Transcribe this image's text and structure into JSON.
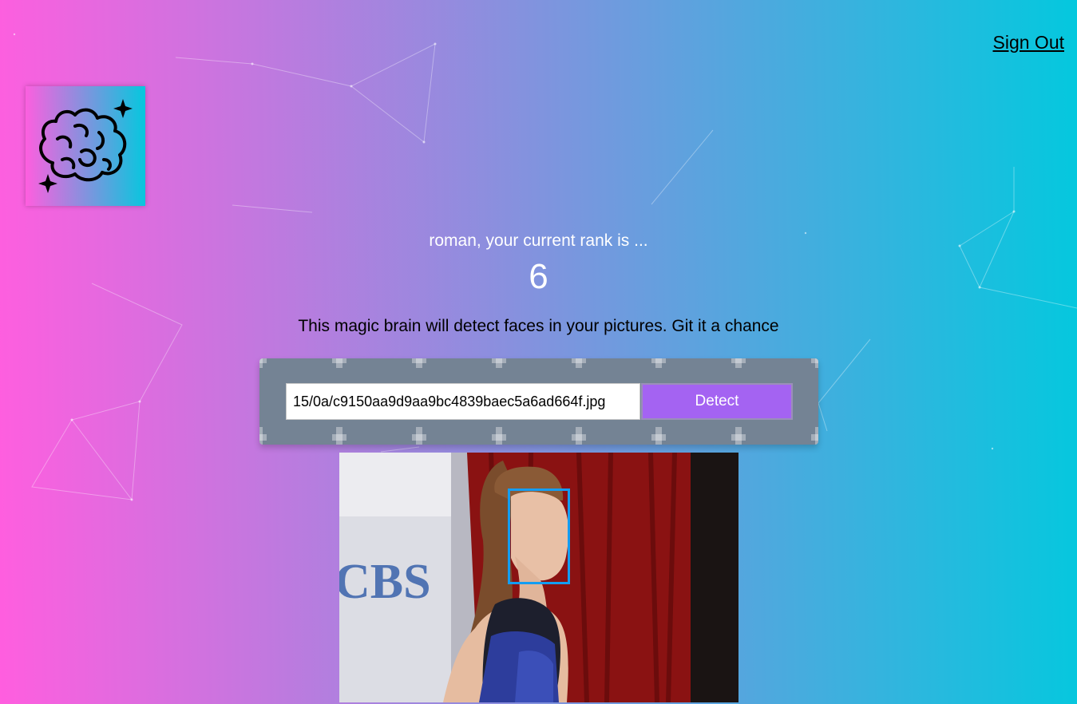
{
  "nav": {
    "signout_label": "Sign Out"
  },
  "logo": {
    "icon": "brain-sparkles-icon"
  },
  "rank": {
    "line": "roman, your current rank is ...",
    "value": "6"
  },
  "description": "This magic brain will detect faces in your pictures. Git it a chance",
  "form": {
    "url_value": "15/0a/c9150aa9d9aa9bc4839baec5a6ad664f.jpg",
    "detect_label": "Detect"
  },
  "photo": {
    "backdrop_text": "CBS",
    "face_box_color": "#149df2"
  },
  "colors": {
    "gradient_start": "#ff5edf",
    "gradient_end": "#04c8de",
    "button": "#a463f2",
    "panel": "#748394"
  }
}
